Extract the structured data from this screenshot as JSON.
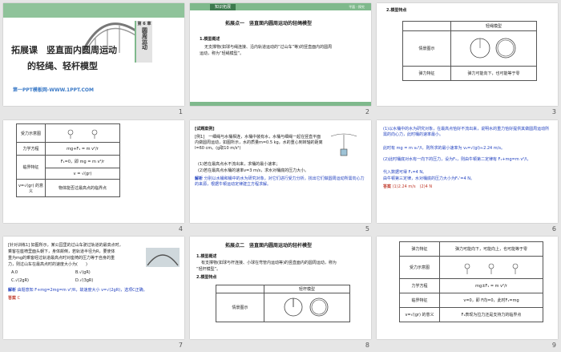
{
  "slides": {
    "s1": {
      "title": "拓展课　竖直面内圆周运动",
      "subtitle": "的轻绳、轻杆模型",
      "footer": "第一PPT模板网-WWW.1PPT.COM",
      "side_chapter": "第 6 章",
      "side_label": "圆周运动",
      "number": "1"
    },
    "s2": {
      "tag": "知识拓展",
      "tag_right": "平面 · 探究",
      "heading": "拓展点一　竖直面内圆周运动的轻绳模型",
      "item1": "1.模型概述",
      "body1": "无支撑物(如球与绳连接、沿内轨道运动的“过山车”等)的竖直面内的圆周",
      "body2": "运动，称为“轻绳模型”。",
      "number": "2"
    },
    "s3": {
      "item2": "2.模型特点",
      "col_header": "轻绳模型",
      "row1": "情景图示",
      "row2": "弹力特征",
      "row2_val": "弹力可能向下，也可能等于零",
      "number": "3"
    },
    "s4": {
      "rows": [
        {
          "k": "受力示意图",
          "v": ""
        },
        {
          "k": "力学方程",
          "v": "mg+F₁ = m v²/r"
        },
        {
          "k": "临界特征",
          "v": "F₁=0，即 mg = m v²/r"
        },
        {
          "k": "",
          "v": "v = √(gr)"
        },
        {
          "k": "v=√(gr) 的意义",
          "v": "物体能否过最高点的临界点"
        }
      ],
      "number": "4"
    },
    "s5": {
      "label": "[试题案例]",
      "ex": "[例1]　一细绳与水桶相连，水桶中装有水，水桶与细绳一起在竖直平面内做圆周运动，如图所示，水的质量m=0.5 kg，水的重心到转轴的距离l=60 cm。(g取10 m/s²)",
      "q1": "(1)若在最高点水不流出来，求桶的最小速率；",
      "q2": "(2)若在最高点水桶的速率v=3 m/s，求水对桶底的压力大小。",
      "ans_label": "解析",
      "ans": "分别以水桶和桶中的水为研究对象，对它们进行受力分析，找出它们做圆周运动所需向心力的来源，根据牛顿运动定律建立方程求解。",
      "number": "5"
    },
    "s6": {
      "l1": "(1)以水桶中的水为研究对象，在最高点恰好不流出来，说明水的重力恰好提供其做圆周运动所需的向心力，此时桶的速率最小。",
      "l2": "此时有 mg = m v₀²/l，则所求的最小速率为 v₀=√(gl)≈2.24 m/s。",
      "l3": "(2)此时桶底对水有一向下的压力，设为F₁，则由牛顿第二定律有 F₁+mg=m v²/l，",
      "l4": "代入数据可得 F₁=4 N。",
      "l5": "由牛顿第三定律，水对桶底的压力大小为F₁'=4 N。",
      "ans_label": "答案",
      "ans": "(1)2.24 m/s　(2)4 N",
      "number": "6"
    },
    "s7": {
      "l1": "[针对训练1] 如图所示，某公园里的过山车驶过轨道的最高点时，",
      "l2": "乘客在座椅里面头朝下，身体颠倒，若轨道半径为R，要使体",
      "l3": "重为mg的乘客经过轨道最高点时对座椅的压力等于自身的重",
      "l4": "力，则过山车在最高点时的速度大小为(　　)",
      "opts": [
        "A.0",
        "B.√(gR)",
        "C.√(2gR)",
        "D.√(3gR)"
      ],
      "sol_label": "解析",
      "sol": "由题意知 F+mg=2mg=m v²/R，故速度大小 v=√(2gR)，选项C正确。",
      "ans_label": "答案",
      "ans": "C",
      "number": "7"
    },
    "s8": {
      "heading": "拓展点二　竖直面内圆周运动的轻杆模型",
      "item1": "1.模型概述",
      "body1": "有支撑物(如球与杆连接、小球在弯管内运动等)的竖直面内的圆周运动，称为",
      "body2": "“轻杆模型”。",
      "item2": "2.模型特点",
      "col_header": "轻杆模型",
      "row1": "情景图示",
      "number": "8"
    },
    "s9": {
      "rows": [
        {
          "k": "弹力特征",
          "v": "弹力可能向下，可能向上，也可能等于零"
        },
        {
          "k": "受力示意图",
          "v": ""
        },
        {
          "k": "力学方程",
          "v": "mg±F₁ = m v²/r"
        },
        {
          "k": "临界特征",
          "v": "v=0，即 F向=0，此时F₁=mg"
        },
        {
          "k": "v=√(gr) 的意义",
          "v": "F₁表现为拉力还是支持力的临界点"
        }
      ],
      "number": "9"
    }
  },
  "colors": {
    "accent_green": "#7fb98c",
    "dark_green": "#3d7a4e",
    "link_blue": "#1f3fbf",
    "answer_red": "#c0392b"
  }
}
